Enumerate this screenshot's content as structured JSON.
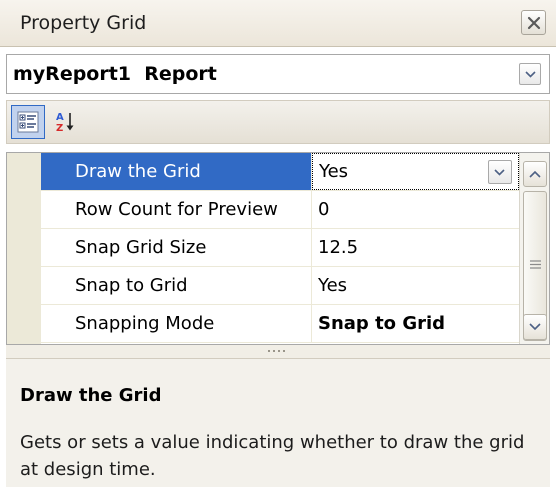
{
  "window": {
    "title": "Property Grid",
    "close_icon": "close-icon"
  },
  "selector": {
    "object_name": "myReport1",
    "object_type": "Report"
  },
  "toolbar": {
    "buttons": [
      {
        "icon": "categorized-view-icon",
        "active": true
      },
      {
        "icon": "sort-alphabetical-icon",
        "active": false
      }
    ]
  },
  "grid": {
    "rows": [
      {
        "name": "Draw the Grid",
        "value": "Yes",
        "selected": true,
        "bold": false
      },
      {
        "name": "Row Count for Preview",
        "value": "0",
        "selected": false,
        "bold": false
      },
      {
        "name": "Snap Grid Size",
        "value": "12.5",
        "selected": false,
        "bold": false
      },
      {
        "name": "Snap to Grid",
        "value": "Yes",
        "selected": false,
        "bold": false
      },
      {
        "name": "Snapping Mode",
        "value": "Snap to Grid",
        "selected": false,
        "bold": true
      }
    ]
  },
  "description": {
    "title": "Draw the Grid",
    "text": "Gets or sets a value indicating whether to draw the grid at design time."
  },
  "colors": {
    "selection": "#316ac5",
    "gutter": "#ece9d8",
    "title_bar": "#ece6da"
  }
}
